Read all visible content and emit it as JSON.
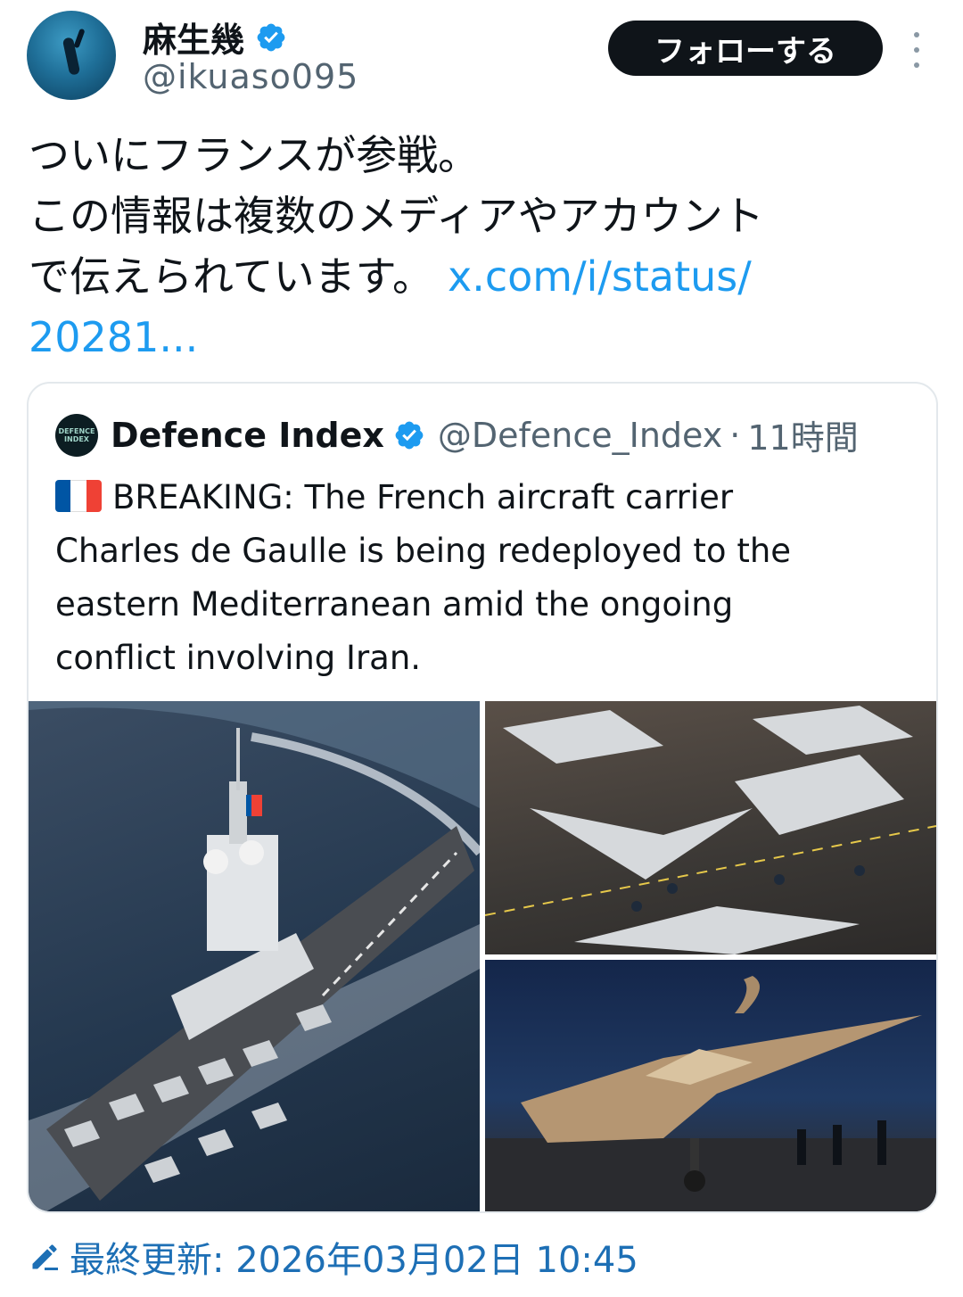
{
  "author": {
    "display_name": "麻生幾",
    "handle": "@ikuaso095",
    "follow_label": "フォローする"
  },
  "tweet": {
    "text_line1": "ついにフランスが参戦。",
    "text_line2": "この情報は複数のメディアやアカウント",
    "text_line3": "で伝えられています。",
    "link_part1": "x.com/i/status/",
    "link_part2": "20281..."
  },
  "quote": {
    "logo_text_line1": "DEFENCE",
    "logo_text_line2": "INDEX",
    "name": "Defence Index",
    "handle": "@Defence_Index",
    "separator": "·",
    "time": "11時間",
    "text_line1": "BREAKING: The French aircraft carrier",
    "text_line2": "Charles de Gaulle is being redeployed to the",
    "text_line3": "eastern Mediterranean amid the ongoing",
    "text_line4": "conflict involving Iran.",
    "flag_colors": [
      "#0055a4",
      "#ffffff",
      "#ef4135"
    ]
  },
  "footer": {
    "last_updated": "最終更新: 2026年03月02日 10:45"
  },
  "colors": {
    "link": "#1d9bf0",
    "verified": "#1d9bf0",
    "follow_bg": "#0f1419",
    "footer": "#1d6fb5"
  }
}
